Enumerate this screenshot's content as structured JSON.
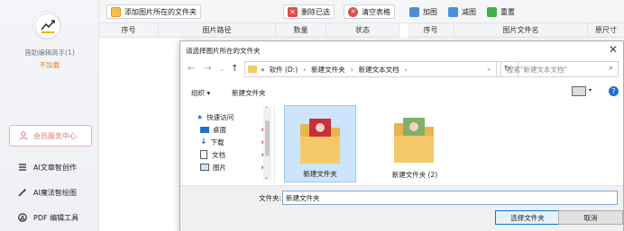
{
  "sidebar": {
    "app_name": "首助编辑高手(1)",
    "status": "不加载",
    "member": "会员服务中心",
    "items": [
      {
        "label": "AI文章智创作"
      },
      {
        "label": "AI魔法智绘图"
      },
      {
        "label": "PDF 编辑工具"
      }
    ]
  },
  "toolbar": {
    "add_folder": "添加图片所在的文件夹",
    "delete_selected": "删除已选",
    "clear_table": "清空表格",
    "add_image": "加图",
    "remove_image": "减图",
    "reset": "重置"
  },
  "table_left": {
    "columns": [
      "序号",
      "图片路径",
      "数量",
      "状态"
    ]
  },
  "table_right": {
    "columns": [
      "序号",
      "图片文件名",
      "原尺寸"
    ]
  },
  "dialog": {
    "title": "请选择图片所在的文件夹",
    "close": "✕",
    "address": {
      "prefix": "«",
      "parts": [
        "软件 (D:)",
        "新建文件夹",
        "新建文本文档"
      ]
    },
    "search_placeholder": "搜索\"新建文本文档\"",
    "organize": "组织 ▾",
    "new_folder": "新建文件夹",
    "tree": [
      {
        "label": "快速访问"
      },
      {
        "label": "桌面"
      },
      {
        "label": "下载"
      },
      {
        "label": "文档"
      },
      {
        "label": "图片"
      }
    ],
    "files": [
      {
        "label": "新建文件夹"
      },
      {
        "label": "新建文件夹 (2)"
      }
    ],
    "folder_label": "文件夹:",
    "folder_value": "新建文件夹",
    "select_button": "选择文件夹",
    "cancel_button": "取消"
  },
  "colors": {
    "accent": "#0078d7",
    "member": "#d67a7a",
    "status": "#e08a2a",
    "folder": "#f5c869"
  }
}
